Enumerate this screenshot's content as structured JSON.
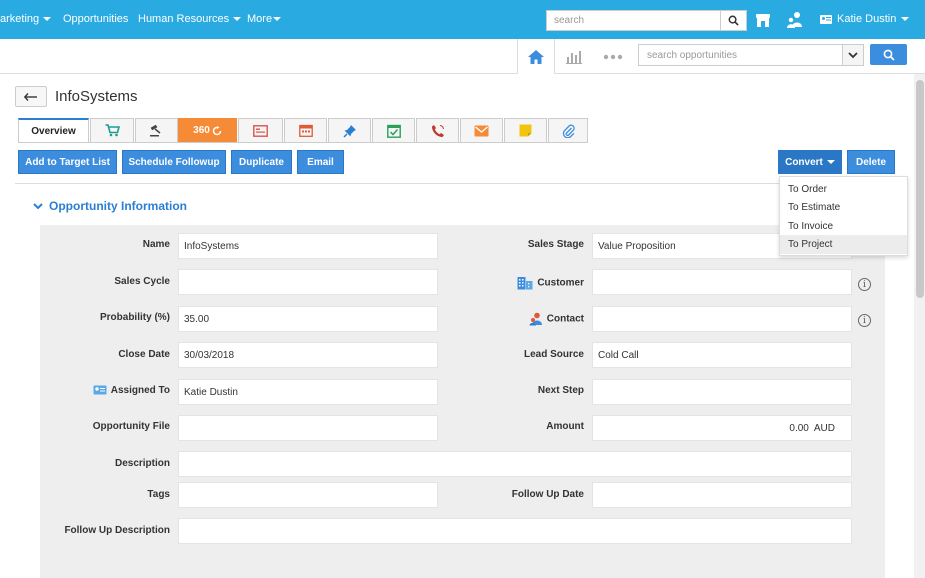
{
  "topnav": {
    "items": [
      "arketing",
      "Opportunities",
      "Human Resources",
      "More"
    ],
    "search_placeholder": "search",
    "user_name": "Katie Dustin"
  },
  "subbar": {
    "search_placeholder": "search opportunities"
  },
  "record": {
    "title": "InfoSystems"
  },
  "tabs": {
    "overview": "Overview",
    "label_360": "360"
  },
  "actions": {
    "add_to_target_list": "Add to Target List",
    "schedule_followup": "Schedule Followup",
    "duplicate": "Duplicate",
    "email": "Email",
    "convert": "Convert",
    "delete": "Delete"
  },
  "convert_menu": [
    "To Order",
    "To Estimate",
    "To Invoice",
    "To Project"
  ],
  "section": {
    "title": "Opportunity Information"
  },
  "fields": {
    "name": {
      "label": "Name",
      "value": "InfoSystems"
    },
    "sales_stage": {
      "label": "Sales Stage",
      "value": "Value Proposition"
    },
    "sales_cycle": {
      "label": "Sales Cycle",
      "value": ""
    },
    "customer": {
      "label": "Customer",
      "value": ""
    },
    "probability": {
      "label": "Probability (%)",
      "value": "35.00"
    },
    "contact": {
      "label": "Contact",
      "value": ""
    },
    "close_date": {
      "label": "Close Date",
      "value": "30/03/2018"
    },
    "lead_source": {
      "label": "Lead Source",
      "value": "Cold Call"
    },
    "assigned_to": {
      "label": "Assigned To",
      "value": "Katie Dustin"
    },
    "next_step": {
      "label": "Next Step",
      "value": ""
    },
    "opportunity_file": {
      "label": "Opportunity File",
      "value": ""
    },
    "amount": {
      "label": "Amount",
      "value": "0.00  AUD"
    },
    "description": {
      "label": "Description",
      "value": ""
    },
    "tags": {
      "label": "Tags",
      "value": ""
    },
    "follow_up_date": {
      "label": "Follow Up Date",
      "value": ""
    },
    "follow_up_description": {
      "label": "Follow Up Description",
      "value": ""
    }
  },
  "colors": {
    "topbar": "#29abe2",
    "primary_button": "#3c8dde",
    "section_title": "#2a7fd4",
    "tab_360": "#f58b36"
  }
}
